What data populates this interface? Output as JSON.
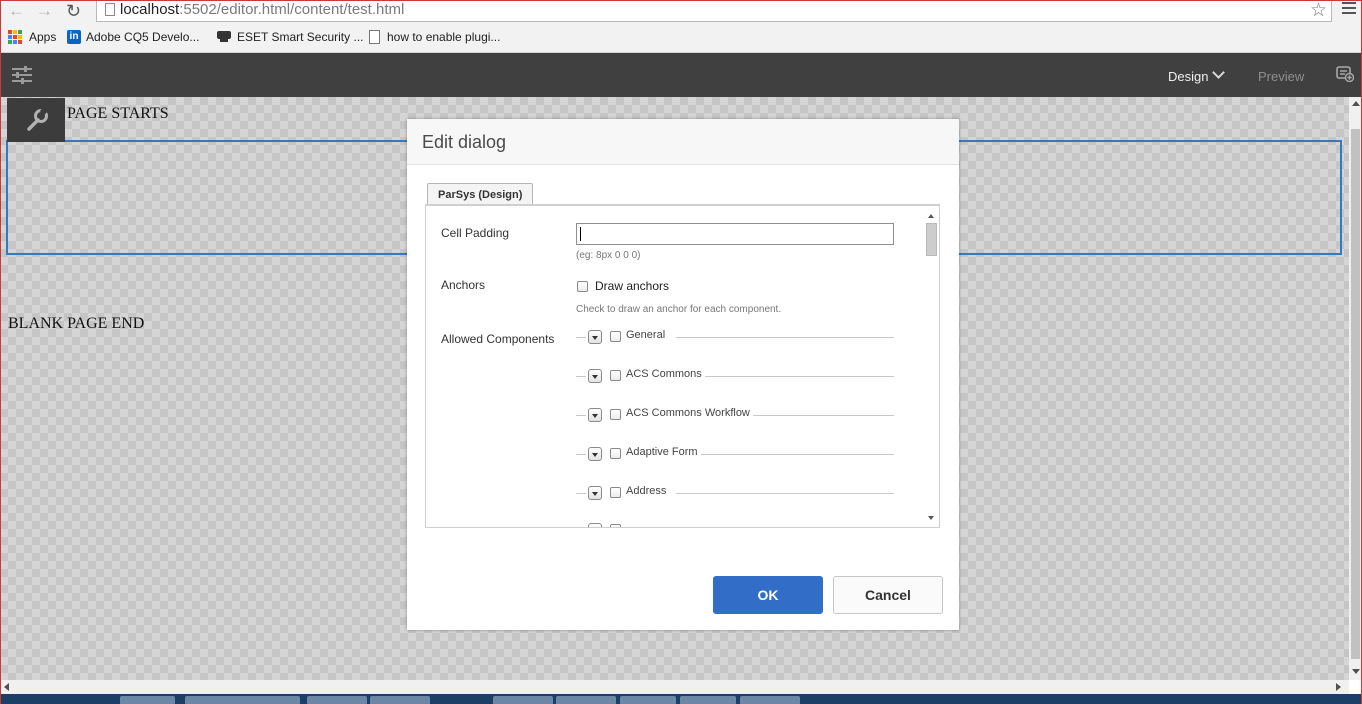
{
  "browser": {
    "url_host": "localhost",
    "url_rest": ":5502/editor.html/content/test.html",
    "bookmarks": [
      {
        "label": "Apps"
      },
      {
        "label": "Adobe CQ5 Develo..."
      },
      {
        "label": "ESET Smart Security ..."
      },
      {
        "label": "how to enable plugi..."
      }
    ]
  },
  "editor_bar": {
    "mode_label": "Design",
    "preview_label": "Preview"
  },
  "page": {
    "start_text": "PAGE STARTS",
    "end_text": "BLANK PAGE END"
  },
  "dialog": {
    "title": "Edit dialog",
    "tab_label": "ParSys (Design)",
    "cell_padding": {
      "label": "Cell Padding",
      "value": "",
      "hint": "(eg: 8px 0 0 0)"
    },
    "anchors": {
      "label": "Anchors",
      "checkbox_label": "Draw anchors",
      "hint": "Check to draw an anchor for each component."
    },
    "allowed_components": {
      "label": "Allowed Components",
      "groups": [
        {
          "name": "General"
        },
        {
          "name": "ACS Commons"
        },
        {
          "name": "ACS Commons Workflow"
        },
        {
          "name": "Adaptive Form"
        },
        {
          "name": "Address"
        }
      ]
    },
    "ok_label": "OK",
    "cancel_label": "Cancel"
  },
  "colors": {
    "accent": "#326ec8",
    "editor_bar": "#404040",
    "parsys_outline": "#3a82c9"
  }
}
